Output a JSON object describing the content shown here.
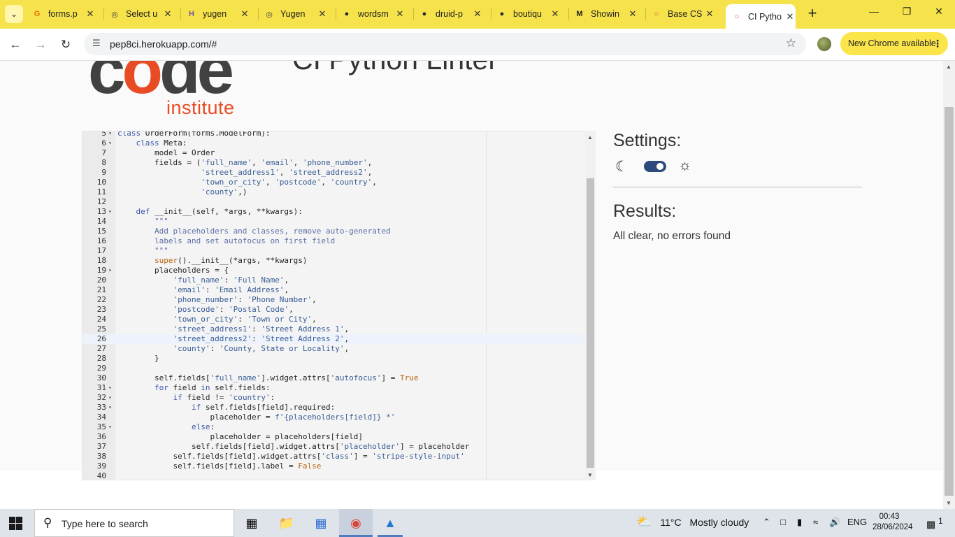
{
  "browser": {
    "tabs": [
      {
        "title": "forms.p",
        "icon": "google-g-icon",
        "color": "#e8710a"
      },
      {
        "title": "Select u",
        "icon": "globe-icon",
        "color": "#444444"
      },
      {
        "title": "yugen",
        "icon": "heroku-icon",
        "color": "#79589f"
      },
      {
        "title": "Yugen",
        "icon": "globe-icon",
        "color": "#444444"
      },
      {
        "title": "wordsm",
        "icon": "github-icon",
        "color": "#24292f"
      },
      {
        "title": "druid-p",
        "icon": "github-icon",
        "color": "#24292f"
      },
      {
        "title": "boutiqu",
        "icon": "github-icon",
        "color": "#24292f"
      },
      {
        "title": "Showin",
        "icon": "mu-icon",
        "color": "#222222"
      },
      {
        "title": "Base CS",
        "icon": "ci-icon",
        "color": "#e84c24"
      },
      {
        "title": "CI Pytho",
        "icon": "ci-icon",
        "color": "#e84c24"
      }
    ],
    "url": "pep8ci.herokuapp.com/#",
    "update_label": "New Chrome available"
  },
  "page": {
    "title": "CI Python Linter",
    "logo_word": "code",
    "logo_sub": "institute",
    "settings_heading": "Settings:",
    "results_heading": "Results:",
    "results_message": "All clear, no errors found",
    "dark_mode_enabled": true
  },
  "editor": {
    "current_line": 26,
    "lines": [
      {
        "n": "5",
        "fold": true,
        "code": "class OrderForm(forms.ModelForm):"
      },
      {
        "n": "6",
        "fold": true,
        "code": "    class Meta:"
      },
      {
        "n": "7",
        "fold": false,
        "code": "        model = Order"
      },
      {
        "n": "8",
        "fold": false,
        "code": "        fields = ('full_name', 'email', 'phone_number',"
      },
      {
        "n": "9",
        "fold": false,
        "code": "                  'street_address1', 'street_address2',"
      },
      {
        "n": "10",
        "fold": false,
        "code": "                  'town_or_city', 'postcode', 'country',"
      },
      {
        "n": "11",
        "fold": false,
        "code": "                  'county',)"
      },
      {
        "n": "12",
        "fold": false,
        "code": ""
      },
      {
        "n": "13",
        "fold": true,
        "code": "    def __init__(self, *args, **kwargs):"
      },
      {
        "n": "14",
        "fold": false,
        "code": "        \"\"\""
      },
      {
        "n": "15",
        "fold": false,
        "code": "        Add placeholders and classes, remove auto-generated"
      },
      {
        "n": "16",
        "fold": false,
        "code": "        labels and set autofocus on first field"
      },
      {
        "n": "17",
        "fold": false,
        "code": "        \"\"\""
      },
      {
        "n": "18",
        "fold": false,
        "code": "        super().__init__(*args, **kwargs)"
      },
      {
        "n": "19",
        "fold": true,
        "code": "        placeholders = {"
      },
      {
        "n": "20",
        "fold": false,
        "code": "            'full_name': 'Full Name',"
      },
      {
        "n": "21",
        "fold": false,
        "code": "            'email': 'Email Address',"
      },
      {
        "n": "22",
        "fold": false,
        "code": "            'phone_number': 'Phone Number',"
      },
      {
        "n": "23",
        "fold": false,
        "code": "            'postcode': 'Postal Code',"
      },
      {
        "n": "24",
        "fold": false,
        "code": "            'town_or_city': 'Town or City',"
      },
      {
        "n": "25",
        "fold": false,
        "code": "            'street_address1': 'Street Address 1',"
      },
      {
        "n": "26",
        "fold": false,
        "code": "            'street_address2': 'Street Address 2',"
      },
      {
        "n": "27",
        "fold": false,
        "code": "            'county': 'County, State or Locality',"
      },
      {
        "n": "28",
        "fold": false,
        "code": "        }"
      },
      {
        "n": "29",
        "fold": false,
        "code": ""
      },
      {
        "n": "30",
        "fold": false,
        "code": "        self.fields['full_name'].widget.attrs['autofocus'] = True"
      },
      {
        "n": "31",
        "fold": true,
        "code": "        for field in self.fields:"
      },
      {
        "n": "32",
        "fold": true,
        "code": "            if field != 'country':"
      },
      {
        "n": "33",
        "fold": true,
        "code": "                if self.fields[field].required:"
      },
      {
        "n": "34",
        "fold": false,
        "code": "                    placeholder = f'{placeholders[field]} *'"
      },
      {
        "n": "35",
        "fold": true,
        "code": "                else:"
      },
      {
        "n": "36",
        "fold": false,
        "code": "                    placeholder = placeholders[field]"
      },
      {
        "n": "37",
        "fold": false,
        "code": "                self.fields[field].widget.attrs['placeholder'] = placeholder"
      },
      {
        "n": "38",
        "fold": false,
        "code": "            self.fields[field].widget.attrs['class'] = 'stripe-style-input'"
      },
      {
        "n": "39",
        "fold": false,
        "code": "            self.fields[field].label = False"
      },
      {
        "n": "40",
        "fold": false,
        "code": ""
      }
    ]
  },
  "taskbar": {
    "search_placeholder": "Type here to search",
    "weather_temp": "11°C",
    "weather_desc": "Mostly cloudy",
    "lang": "ENG",
    "time": "00:43",
    "date": "28/06/2024",
    "notification_count": "1"
  }
}
